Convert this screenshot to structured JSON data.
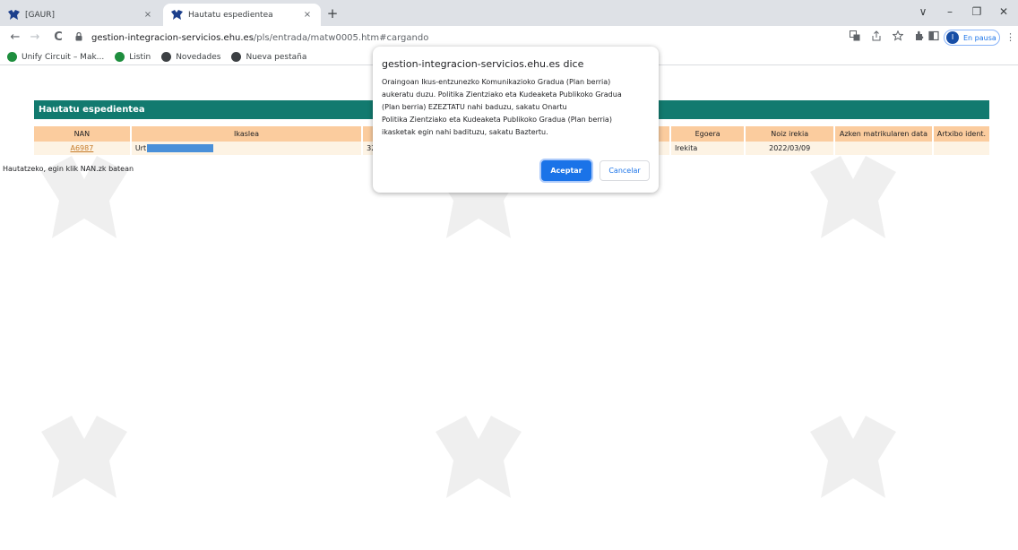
{
  "browser": {
    "tabs": [
      {
        "title": "[GAUR]",
        "close": "×"
      },
      {
        "title": "Hautatu espedientea",
        "close": "×"
      }
    ],
    "new_tab": "+",
    "window_controls": {
      "down": "∨",
      "minimize": "–",
      "restore": "❐",
      "close": "✕"
    },
    "nav": {
      "back": "←",
      "forward": "→",
      "reload": "C"
    },
    "url_host": "gestion-integracion-servicios.ehu.es",
    "url_path": "/pls/entrada/matw0005.htm#cargando",
    "profile_initial": "I",
    "profile_label": "En pausa",
    "bookmarks": [
      {
        "label": "Unify Circuit – Mak...",
        "color": "#1e8e3e"
      },
      {
        "label": "Listin",
        "color": "#1e8e3e"
      },
      {
        "label": "Novedades",
        "color": "#3c4043"
      },
      {
        "label": "Nueva pestaña",
        "color": "#3c4043"
      }
    ]
  },
  "panel": {
    "title": "Hautatu espedientea",
    "columns": [
      "NAN",
      "Ikaslea",
      "",
      "",
      "",
      "Egoera",
      "Noiz irekia",
      "Azken matrikularen data",
      "Artxibo ident."
    ],
    "row": {
      "nan": "A6987",
      "ikaslea": "Urt",
      "col3": "32",
      "egoera": "Irekita",
      "noiz_irekia": "2022/03/09",
      "azken": "",
      "artxibo": ""
    },
    "hint": "Hautatzeko, egin klik NAN.zk batean"
  },
  "dialog": {
    "title": "gestion-integracion-servicios.ehu.es dice",
    "message": "Oraingoan Ikus-entzunezko Komunikazioko Gradua (Plan berria)\naukeratu duzu. Politika Zientziako eta Kudeaketa Publikoko Gradua\n(Plan berria) EZEZTATU nahi baduzu, sakatu Onartu\nPolitika Zientziako eta Kudeaketa Publikoko Gradua (Plan berria)\nikasketak egin nahi badituzu, sakatu Baztertu.",
    "ok_label": "Aceptar",
    "cancel_label": "Cancelar"
  },
  "colors": {
    "header_teal": "#127a6f",
    "table_header": "#fbcc9e",
    "table_row": "#fdf3e4",
    "accent_blue": "#1a73e8"
  }
}
